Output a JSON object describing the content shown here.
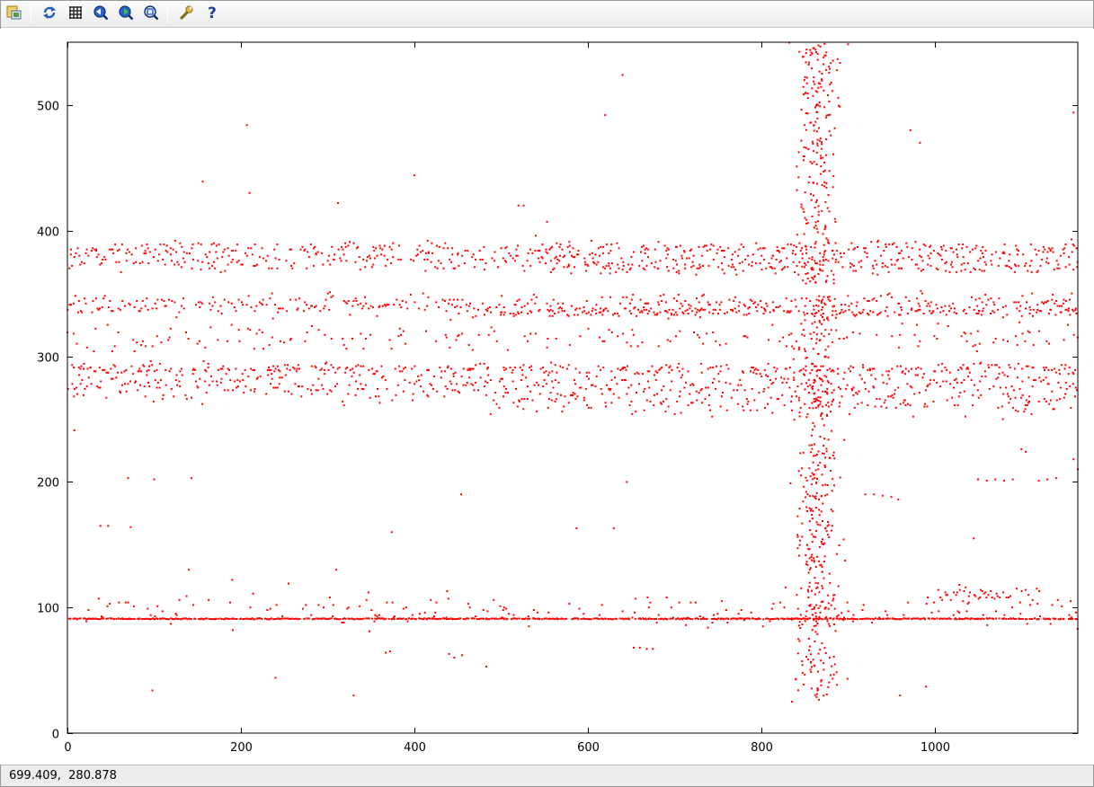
{
  "toolbar": {
    "buttons": [
      {
        "icon": "export-icon"
      },
      {
        "icon": "replot-icon"
      },
      {
        "icon": "grid-icon"
      },
      {
        "icon": "zoom-previous-icon"
      },
      {
        "icon": "zoom-next-icon"
      },
      {
        "icon": "zoom-autoscale-icon"
      },
      {
        "icon": "options-wrench-icon"
      },
      {
        "icon": "help-icon"
      }
    ]
  },
  "status": {
    "coordinates": "699.409,  280.878"
  },
  "colors": {
    "points": "#ff0000",
    "axis": "#000000",
    "toolbar": "#ececec"
  },
  "chart_data": {
    "type": "scatter",
    "title": "",
    "xlabel": "",
    "ylabel": "",
    "xlim": [
      0,
      1165
    ],
    "ylim": [
      0,
      550
    ],
    "x_ticks": [
      0,
      200,
      400,
      600,
      800,
      1000
    ],
    "y_ticks": [
      0,
      100,
      200,
      300,
      400,
      500
    ],
    "grid": false,
    "legend": "none",
    "series": [
      {
        "color": "#ff0000",
        "marker": "dot",
        "bands": [
          {
            "y_center": 91,
            "y_spread": 1,
            "x_range": [
              0,
              1165
            ],
            "density": 0.9
          },
          {
            "y_center": 98,
            "y_spread": 12,
            "x_range": [
              20,
              1165
            ],
            "density": 0.25
          },
          {
            "y_center": 110,
            "y_spread": 8,
            "x_range": [
              1000,
              1120
            ],
            "density": 0.6
          },
          {
            "y_center": 277,
            "y_spread": 14,
            "x_range": [
              0,
              1165
            ],
            "density": 0.7
          },
          {
            "y_center": 262,
            "y_spread": 10,
            "x_range": [
              480,
              1165
            ],
            "density": 0.3
          },
          {
            "y_center": 290,
            "y_spread": 4,
            "x_range": [
              0,
              1165
            ],
            "density": 0.4
          },
          {
            "y_center": 315,
            "y_spread": 12,
            "x_range": [
              0,
              1165
            ],
            "density": 0.25
          },
          {
            "y_center": 341,
            "y_spread": 8,
            "x_range": [
              0,
              1165
            ],
            "density": 0.55
          },
          {
            "y_center": 335,
            "y_spread": 3,
            "x_range": [
              480,
              1165
            ],
            "density": 0.4
          },
          {
            "y_center": 377,
            "y_spread": 9,
            "x_range": [
              0,
              1165
            ],
            "density": 0.55
          },
          {
            "y_center": 386,
            "y_spread": 5,
            "x_range": [
              0,
              1165
            ],
            "density": 0.35
          },
          {
            "y_center": 370,
            "y_spread": 6,
            "x_range": [
              550,
              1165
            ],
            "density": 0.3
          }
        ],
        "vertical_cloud": {
          "x_center": 865,
          "x_spread": 45,
          "y_range": [
            25,
            550
          ],
          "count": 650
        },
        "outliers": [
          [
            98,
            34
          ],
          [
            207,
            484
          ],
          [
            156,
            439
          ],
          [
            210,
            430
          ],
          [
            312,
            422
          ],
          [
            400,
            444
          ],
          [
            640,
            524
          ],
          [
            620,
            492
          ],
          [
            1160,
            494
          ],
          [
            330,
            30
          ],
          [
            240,
            44
          ],
          [
            8,
            241
          ],
          [
            70,
            203
          ],
          [
            100,
            202
          ],
          [
            143,
            203
          ],
          [
            38,
            165
          ],
          [
            47,
            165
          ],
          [
            73,
            164
          ],
          [
            587,
            163
          ],
          [
            630,
            163
          ],
          [
            645,
            200
          ],
          [
            1045,
            155
          ],
          [
            454,
            190
          ],
          [
            374,
            160
          ],
          [
            140,
            130
          ],
          [
            190,
            122
          ],
          [
            255,
            119
          ],
          [
            310,
            130
          ],
          [
            440,
            63
          ],
          [
            446,
            60
          ],
          [
            455,
            62
          ],
          [
            483,
            53
          ],
          [
            367,
            64
          ],
          [
            372,
            65
          ],
          [
            653,
            68
          ],
          [
            660,
            68
          ],
          [
            668,
            67
          ],
          [
            675,
            67
          ],
          [
            990,
            37
          ],
          [
            960,
            30
          ],
          [
            920,
            190
          ],
          [
            930,
            190
          ],
          [
            940,
            189
          ],
          [
            950,
            188
          ],
          [
            958,
            186
          ],
          [
            1050,
            202
          ],
          [
            1060,
            201
          ],
          [
            1070,
            202
          ],
          [
            1080,
            201
          ],
          [
            1090,
            202
          ],
          [
            1120,
            201
          ],
          [
            1130,
            202
          ],
          [
            1140,
            203
          ],
          [
            1160,
            218
          ],
          [
            1165,
            210
          ],
          [
            1100,
            226
          ],
          [
            1105,
            224
          ],
          [
            520,
            420
          ],
          [
            526,
            420
          ],
          [
            540,
            396
          ],
          [
            553,
            407
          ],
          [
            983,
            470
          ],
          [
            972,
            480
          ]
        ]
      }
    ]
  }
}
